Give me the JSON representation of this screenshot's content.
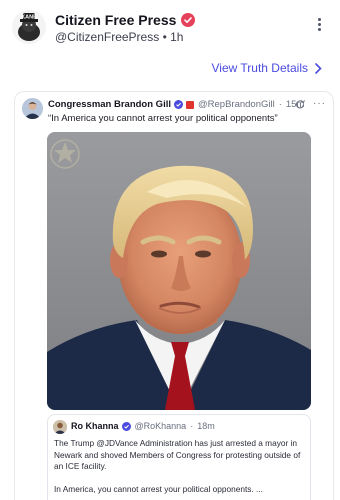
{
  "post": {
    "author_name": "Citizen Free Press",
    "handle": "@CitizenFreePress",
    "time": "1h",
    "meta_separator": "•",
    "avatar_icon": "kane-logo",
    "avatar_text": "KANE",
    "verified_icon": "verified-badge-icon",
    "accent_color": "#e5425b"
  },
  "actions": {
    "view_details_label": "View Truth Details",
    "link_color": "#4b4be0"
  },
  "quote": {
    "author_name": "Congressman Brandon Gill",
    "handle": "@RepBrandonGill",
    "time": "15m",
    "meta_separator": "·",
    "text": "“In America you cannot arrest your political opponents”",
    "photo_description_icon": "mugshot-photo",
    "seal_icon": "seal-icon"
  },
  "nested_quote": {
    "author_name": "Ro Khanna",
    "handle": "@RoKhanna",
    "time": "18m",
    "meta_separator": "·",
    "paragraph_1": "The Trump @JDVance Administration has just arrested a mayor in Newark and shoved Members of Congress for protesting outside of an ICE facility.",
    "paragraph_2": "In America, you cannot arrest your political opponents. ..."
  }
}
